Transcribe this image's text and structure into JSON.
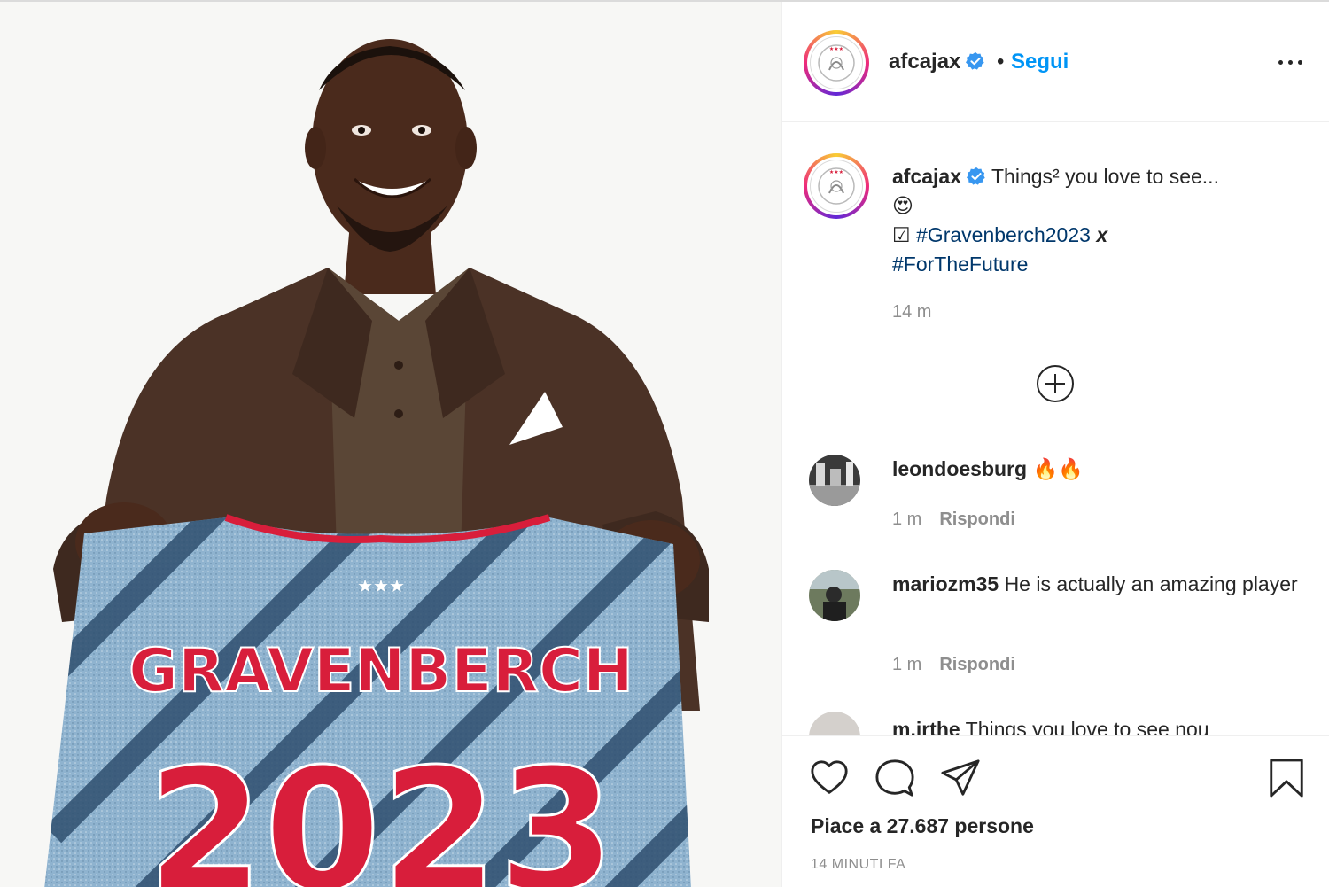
{
  "header": {
    "username": "afcajax",
    "separator": "•",
    "follow_label": "Segui"
  },
  "caption": {
    "username": "afcajax",
    "text": "Things² you love to see...",
    "emoji": "😍",
    "checkbox": "☑",
    "hashtag1": "#Gravenberch2023",
    "x_mark": "x",
    "hashtag2": "#ForTheFuture",
    "time": "14 m"
  },
  "comments": [
    {
      "username": "leondoesburg",
      "text": "🔥🔥",
      "time": "1 m",
      "reply_label": "Rispondi"
    },
    {
      "username": "mariozm35",
      "text": "He is actually an amazing player",
      "time": "1 m",
      "reply_label": "Rispondi"
    },
    {
      "username": "m.irthe",
      "text": "Things you love to see nou"
    }
  ],
  "footer": {
    "likes_text": "Piace a 27.687 persone",
    "posted_time": "14 MINUTI FA"
  },
  "photo": {
    "shirt_name": "GRAVENBERCH",
    "shirt_number": "2023"
  },
  "icons": {
    "more": "more-options-icon",
    "verified": "verified-badge-icon",
    "load_more": "plus-circle-icon",
    "like": "heart-icon",
    "comment": "comment-icon",
    "share": "paper-plane-icon",
    "save": "bookmark-icon"
  },
  "colors": {
    "link": "#0095f6",
    "hashtag": "#00376b",
    "text": "#262626",
    "muted": "#8e8e8e",
    "verified": "#3897f0",
    "shirt_blue": "#8fb3cf",
    "shirt_red": "#d81e3b"
  }
}
